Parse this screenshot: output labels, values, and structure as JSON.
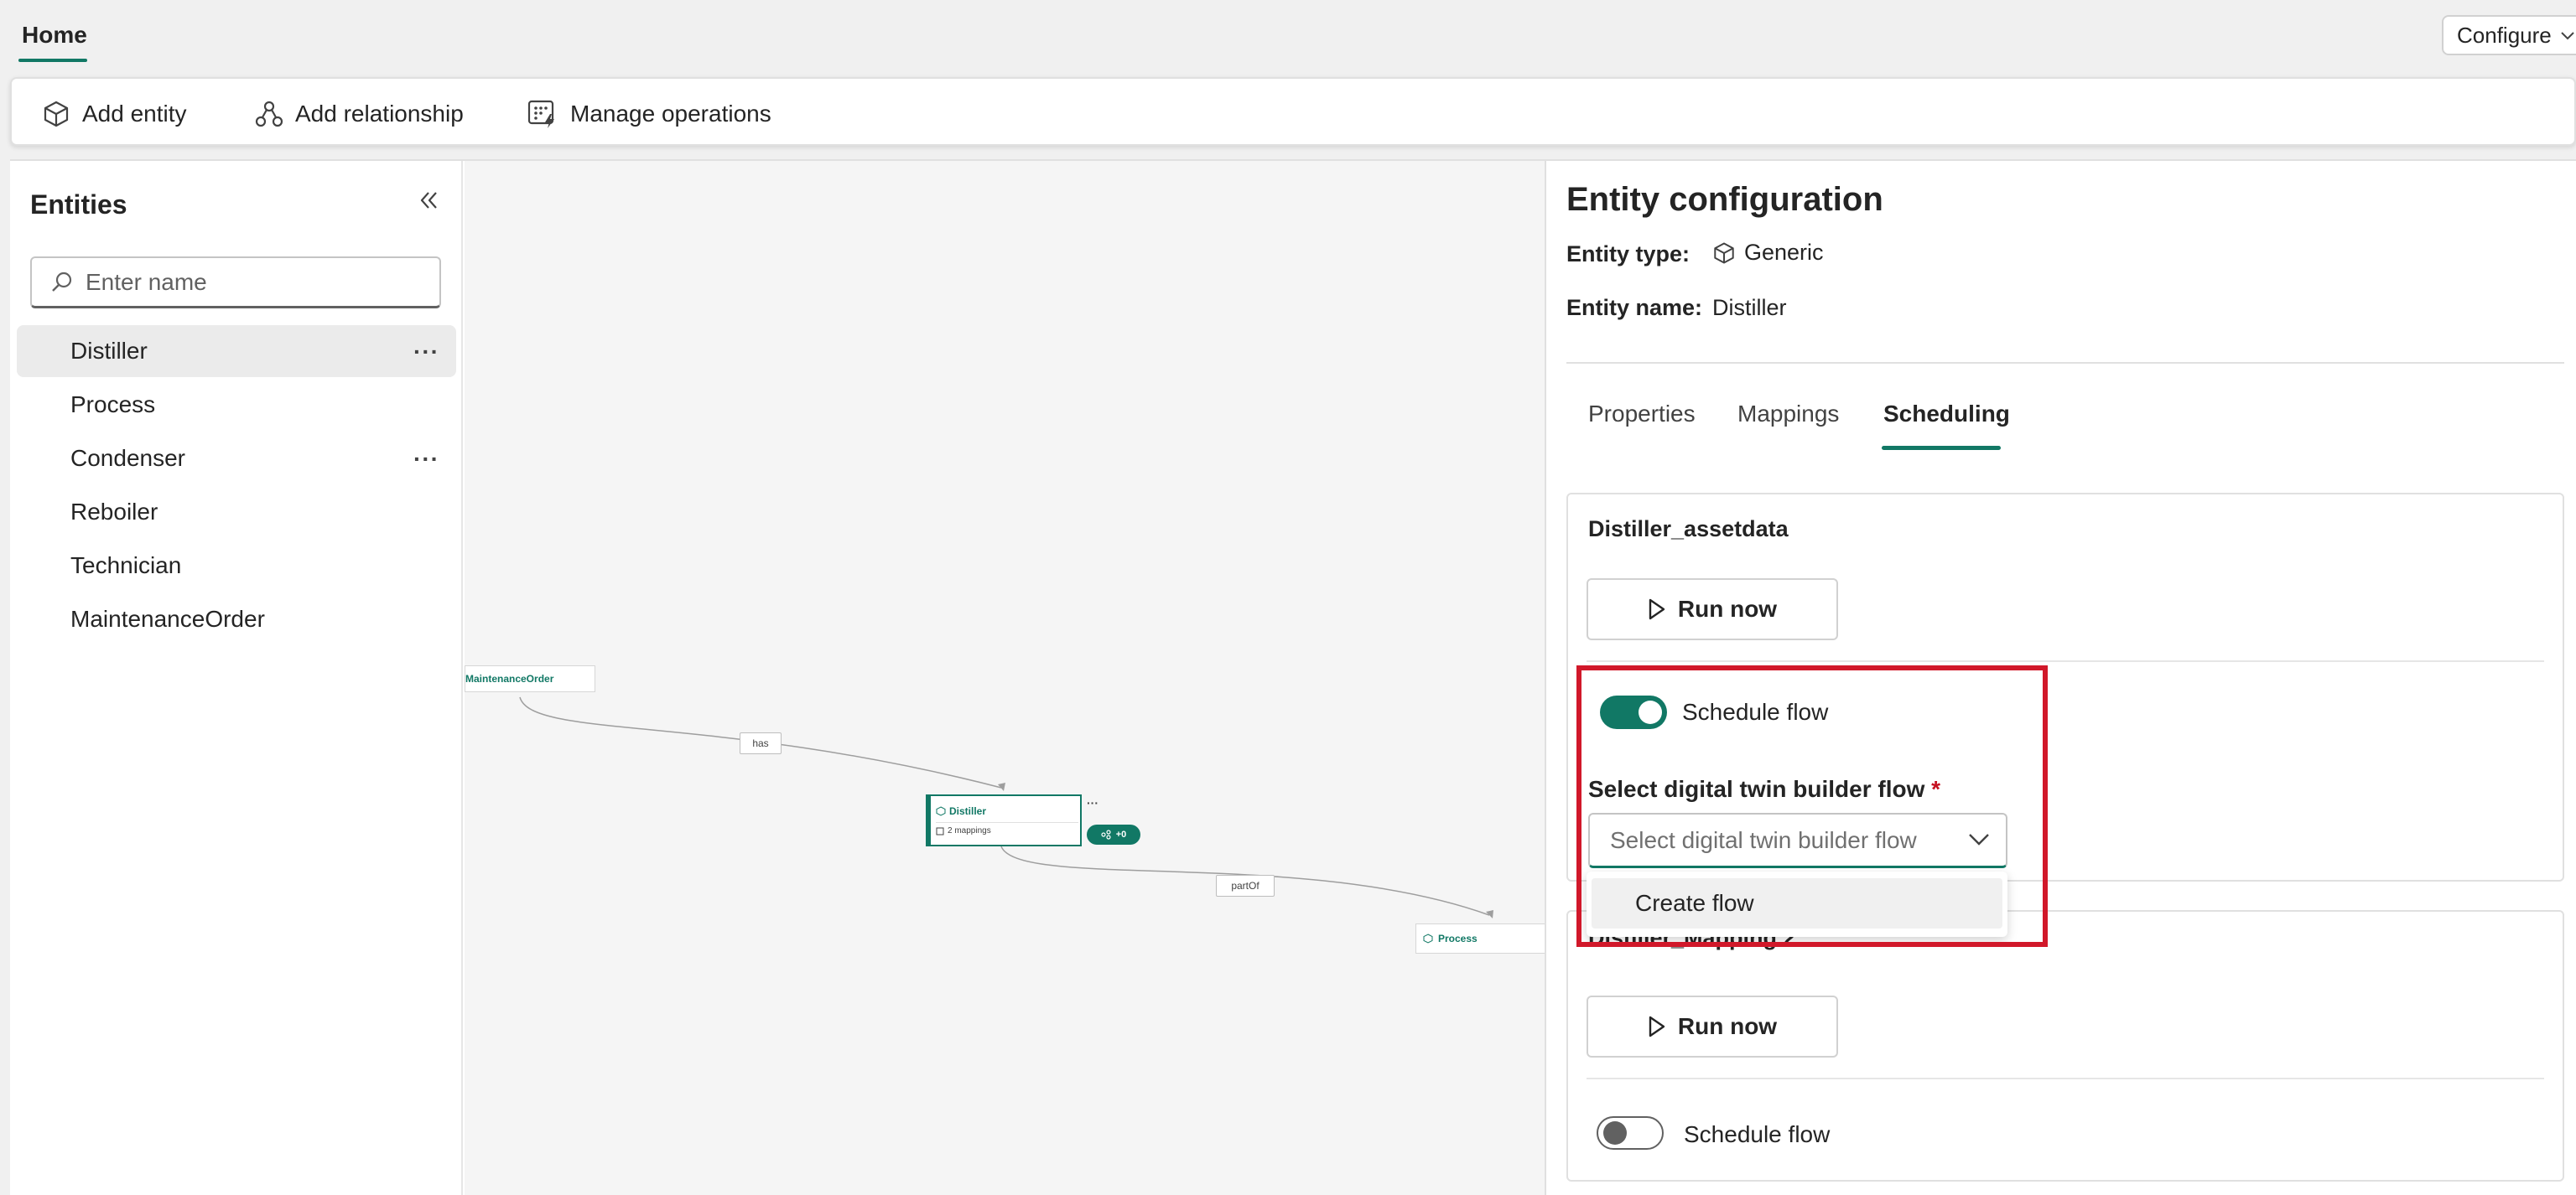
{
  "top_bar": {
    "home_tab": "Home",
    "configure_label": "Configure"
  },
  "toolbar": {
    "add_entity": "Add entity",
    "add_relationship": "Add relationship",
    "manage_operations": "Manage operations"
  },
  "entities_panel": {
    "title": "Entities",
    "search_placeholder": "Enter name",
    "items": [
      {
        "label": "Distiller",
        "selected": true,
        "has_more": true
      },
      {
        "label": "Process",
        "selected": false,
        "has_more": false
      },
      {
        "label": "Condenser",
        "selected": false,
        "has_more": true
      },
      {
        "label": "Reboiler",
        "selected": false,
        "has_more": false
      },
      {
        "label": "Technician",
        "selected": false,
        "has_more": false
      },
      {
        "label": "MaintenanceOrder",
        "selected": false,
        "has_more": false
      }
    ],
    "more_glyph": "···"
  },
  "canvas": {
    "nodes": {
      "maintenance_order": "MaintenanceOrder",
      "distiller": "Distiller",
      "distiller_mappings": "2 mappings",
      "distiller_badge": "+0",
      "distiller_more": "···",
      "process": "Process"
    },
    "edges": {
      "has": "has",
      "part_of": "partOf"
    }
  },
  "config": {
    "title": "Entity configuration",
    "entity_type_label": "Entity type:",
    "entity_type_value": "Generic",
    "entity_name_label": "Entity name:",
    "entity_name_value": "Distiller",
    "tabs": [
      {
        "label": "Properties",
        "active": false
      },
      {
        "label": "Mappings",
        "active": false
      },
      {
        "label": "Scheduling",
        "active": true
      }
    ],
    "card1": {
      "title": "Distiller_assetdata",
      "run_now": "Run now",
      "schedule_flow": "Schedule flow",
      "schedule_on": true,
      "flow_label": "Select digital twin builder flow",
      "flow_required": "*",
      "flow_placeholder": "Select digital twin builder flow",
      "dropdown_option": "Create flow"
    },
    "card2": {
      "title": "Distiller_Mapping 2",
      "run_now": "Run now",
      "schedule_flow": "Schedule flow",
      "schedule_on": false
    }
  },
  "colors": {
    "accent": "#117865",
    "highlight": "#d1182a"
  }
}
